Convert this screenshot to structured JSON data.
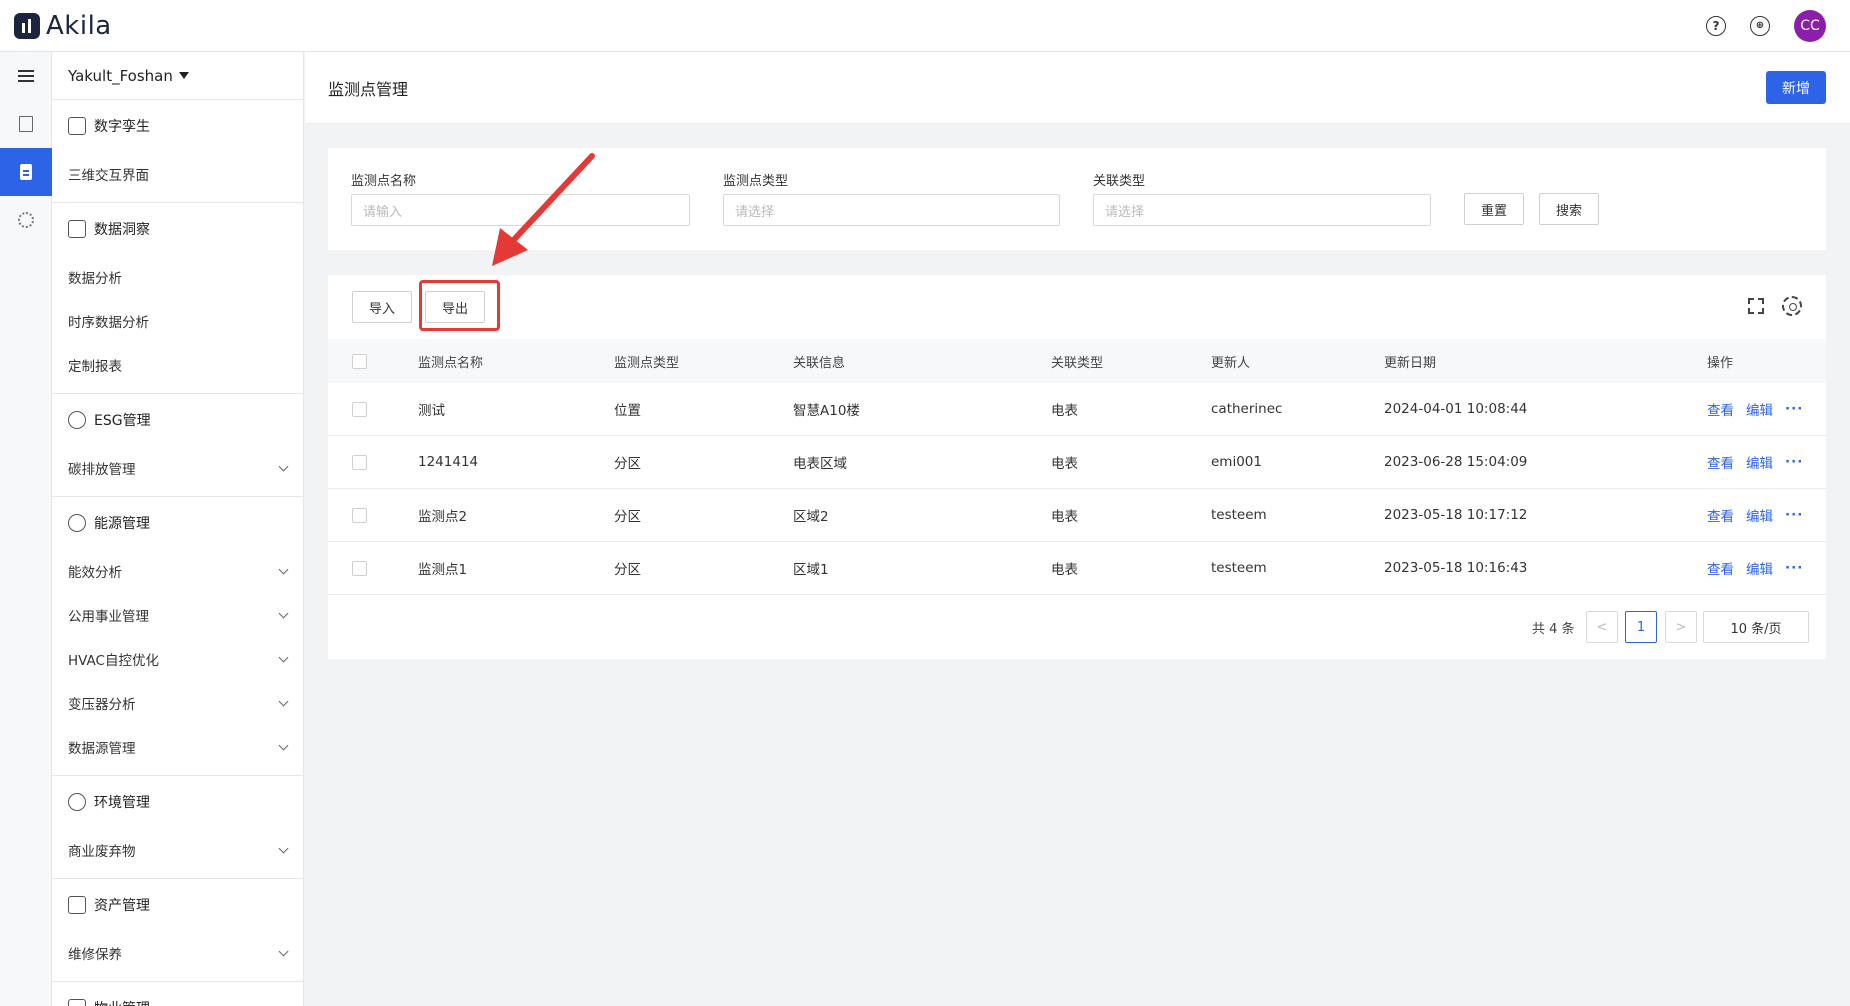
{
  "app": {
    "logo_text": "Akila",
    "avatar_initials": "CC"
  },
  "sidebar": {
    "site": "Yakult_Foshan",
    "groups": [
      {
        "title": "数字孪生",
        "items": [
          {
            "label": "三维交互界面"
          }
        ]
      },
      {
        "title": "数据洞察",
        "items": [
          {
            "label": "数据分析"
          },
          {
            "label": "时序数据分析"
          },
          {
            "label": "定制报表"
          }
        ]
      },
      {
        "title": "ESG管理",
        "items": [
          {
            "label": "碳排放管理"
          }
        ]
      },
      {
        "title": "能源管理",
        "items": [
          {
            "label": "能效分析"
          },
          {
            "label": "公用事业管理"
          },
          {
            "label": "HVAC自控优化"
          },
          {
            "label": "变压器分析"
          },
          {
            "label": "数据源管理"
          }
        ]
      },
      {
        "title": "环境管理",
        "items": [
          {
            "label": "商业废弃物"
          }
        ]
      },
      {
        "title": "资产管理",
        "items": [
          {
            "label": "维修保养"
          }
        ]
      },
      {
        "title": "物业管理",
        "items": []
      }
    ]
  },
  "page": {
    "title": "监测点管理",
    "add_label": "新增"
  },
  "filters": {
    "name_label": "监测点名称",
    "name_placeholder": "请输入",
    "type_label": "监测点类型",
    "type_placeholder": "请选择",
    "assoc_label": "关联类型",
    "assoc_placeholder": "请选择",
    "reset_label": "重置",
    "search_label": "搜索"
  },
  "toolbar": {
    "import_label": "导入",
    "export_label": "导出"
  },
  "table": {
    "columns": [
      "监测点名称",
      "监测点类型",
      "关联信息",
      "关联类型",
      "更新人",
      "更新日期",
      "操作"
    ],
    "view_label": "查看",
    "edit_label": "编辑",
    "more_label": "···",
    "rows": [
      {
        "name": "测试",
        "type": "位置",
        "info": "智慧A10楼",
        "assoc": "电表",
        "user": "catherinec",
        "date": "2024-04-01 10:08:44"
      },
      {
        "name": "1241414",
        "type": "分区",
        "info": "电表区域",
        "assoc": "电表",
        "user": "emi001",
        "date": "2023-06-28 15:04:09"
      },
      {
        "name": "监测点2",
        "type": "分区",
        "info": "区域2",
        "assoc": "电表",
        "user": "testeem",
        "date": "2023-05-18 10:17:12"
      },
      {
        "name": "监测点1",
        "type": "分区",
        "info": "区域1",
        "assoc": "电表",
        "user": "testeem",
        "date": "2023-05-18 10:16:43"
      }
    ]
  },
  "pagination": {
    "total_text": "共 4 条",
    "current_page": "1",
    "page_size": "10 条/页",
    "prev": "<",
    "next": ">"
  },
  "colors": {
    "primary": "#2d63e6",
    "annotation": "#e53935",
    "avatar": "#8b1fa9"
  }
}
